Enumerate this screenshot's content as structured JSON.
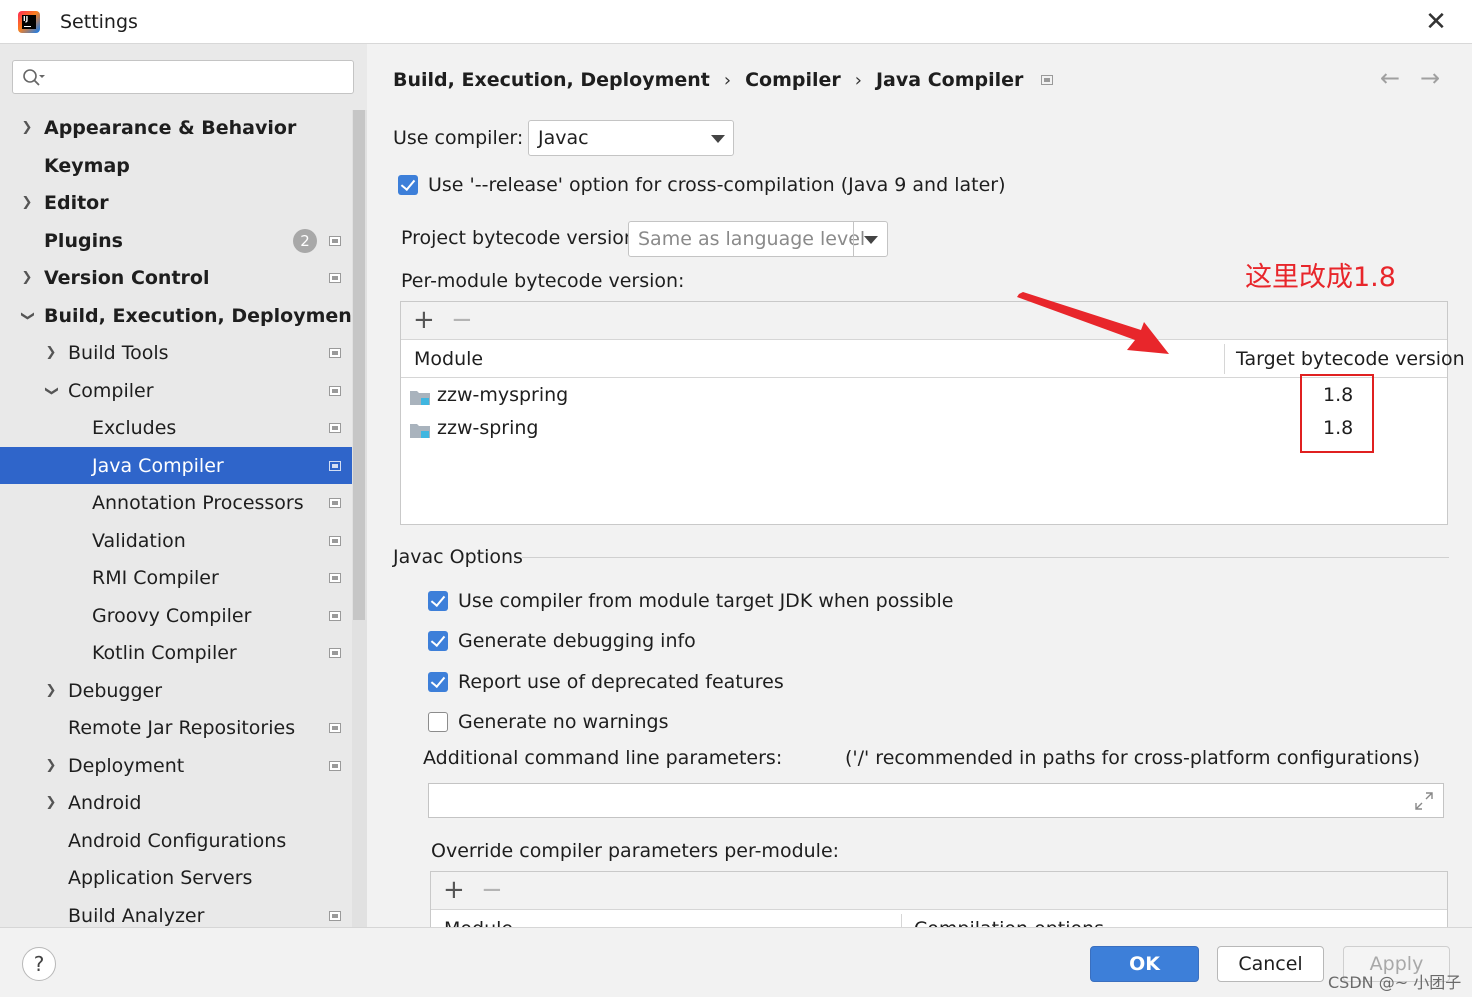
{
  "window": {
    "title": "Settings"
  },
  "search": {
    "placeholder": ""
  },
  "sidebar": {
    "items": [
      {
        "label": "Appearance & Behavior",
        "has_badge": false
      },
      {
        "label": "Keymap"
      },
      {
        "label": "Editor"
      },
      {
        "label": "Plugins",
        "badge": "2"
      },
      {
        "label": "Version Control"
      },
      {
        "label": "Build, Execution, Deployment"
      },
      {
        "label": "Build Tools"
      },
      {
        "label": "Compiler"
      },
      {
        "label": "Excludes"
      },
      {
        "label": "Java Compiler",
        "selected": true
      },
      {
        "label": "Annotation Processors"
      },
      {
        "label": "Validation"
      },
      {
        "label": "RMI Compiler"
      },
      {
        "label": "Groovy Compiler"
      },
      {
        "label": "Kotlin Compiler"
      },
      {
        "label": "Debugger"
      },
      {
        "label": "Remote Jar Repositories"
      },
      {
        "label": "Deployment"
      },
      {
        "label": "Android"
      },
      {
        "label": "Android Configurations"
      },
      {
        "label": "Application Servers"
      },
      {
        "label": "Build Analyzer"
      }
    ]
  },
  "breadcrumb": [
    "Build, Execution, Deployment",
    "Compiler",
    "Java Compiler"
  ],
  "compiler": {
    "use_compiler_label": "Use compiler:",
    "use_compiler_value": "Javac",
    "release_option_label": "Use '--release' option for cross-compilation (Java 9 and later)",
    "release_option_checked": true,
    "project_bytecode_label": "Project bytecode version:",
    "project_bytecode_placeholder": "Same as language level",
    "per_module_label": "Per-module bytecode version:",
    "columns": {
      "module": "Module",
      "target": "Target bytecode version"
    },
    "modules": [
      {
        "name": "zzw-myspring",
        "version": "1.8"
      },
      {
        "name": "zzw-spring",
        "version": "1.8"
      }
    ]
  },
  "annotation": {
    "text": "这里改成1.8",
    "color": "#e8262b"
  },
  "javac": {
    "group_title": "Javac Options",
    "options": [
      {
        "label": "Use compiler from module target JDK when possible",
        "checked": true
      },
      {
        "label": "Generate debugging info",
        "checked": true
      },
      {
        "label": "Report use of deprecated features",
        "checked": true
      },
      {
        "label": "Generate no warnings",
        "checked": false
      }
    ],
    "additional_label": "Additional command line parameters:",
    "additional_hint": "('/' recommended in paths for cross-platform configurations)",
    "additional_value": "",
    "override_label": "Override compiler parameters per-module:",
    "override_columns": {
      "module": "Module",
      "options": "Compilation options"
    }
  },
  "buttons": {
    "help": "?",
    "ok": "OK",
    "cancel": "Cancel",
    "apply": "Apply"
  },
  "watermark": "CSDN @~ 小团子",
  "colors": {
    "accent": "#3d7fd9",
    "selection": "#2f65ca",
    "annotation_red": "#e8262b"
  }
}
